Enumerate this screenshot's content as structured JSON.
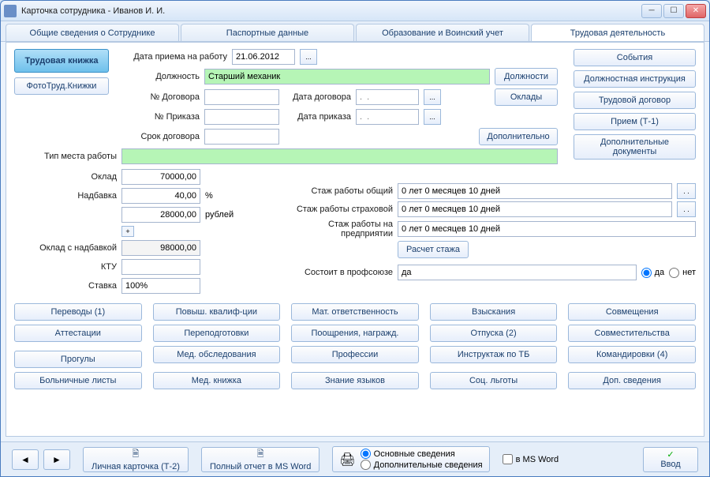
{
  "title": "Карточка сотрудника -  Иванов И. И.",
  "tabs": [
    "Общие сведения о Сотруднике",
    "Паспортные данные",
    "Образование и Воинский учет",
    "Трудовая деятельность"
  ],
  "left": {
    "workbook": "Трудовая книжка",
    "photo": "ФотоТруд.Книжки"
  },
  "right": {
    "events": "События",
    "jobdesc": "Должностная инструкция",
    "contract": "Трудовой  договор",
    "hire": "Прием (Т-1)",
    "adddocs": "Дополнительные документы"
  },
  "fields": {
    "hiredate_lbl": "Дата приема на работу",
    "hiredate": "21.06.2012",
    "position_lbl": "Должность",
    "position": "Старший механик",
    "positions_btn": "Должности",
    "contractno_lbl": "№ Договора",
    "contractdate_lbl": "Дата договора",
    "orderno_lbl": "№ Приказа",
    "orderdate_lbl": "Дата приказа",
    "dateplh": ".  .",
    "salaries_btn": "Оклады",
    "contractterm_lbl": "Срок договора",
    "additional_btn": "Дополнительно",
    "worktype_lbl": "Тип места работы",
    "salary_lbl": "Оклад",
    "salary": "70000,00",
    "bonus_lbl": "Надбавка",
    "bonus_pct": "40,00",
    "pct": "%",
    "bonus_rub": "28000,00",
    "rub": "рублей",
    "salarytotal_lbl": "Оклад с надбавкой",
    "salarytotal": "98000,00",
    "ktu_lbl": "КТУ",
    "rate_lbl": "Ставка",
    "rate": "100%",
    "stazh_total_lbl": "Стаж работы общий",
    "stazh_ins_lbl": "Стаж работы страховой",
    "stazh_ent_lbl": "Стаж работы на предприятии",
    "stazh_val": "0 лет 0 месяцев 10 дней",
    "calc_btn": "Расчет стажа",
    "union_lbl": "Состоит в профсоюзе",
    "union_val": "да",
    "yes": "да",
    "no": "нет"
  },
  "btns": [
    "Переводы (1)",
    "Повыш. квалиф-ции",
    "Мат. ответственность",
    "Взыскания",
    "Совмещения",
    "Аттестации",
    "Переподготовки",
    "Поощрения, награжд.",
    "Отпуска (2)",
    "Совместительства",
    "Прогулы",
    "Мед. обследования",
    "Профессии",
    "Инструктаж по ТБ",
    "Командировки (4)",
    "Больничные листы",
    "Мед. книжка",
    "Знание языков",
    "Соц. льготы",
    "Доп. сведения"
  ],
  "bottom": {
    "t2": "Личная карточка (Т-2)",
    "full": "Полный отчет в MS Word",
    "basic": "Основные сведения",
    "add": "Дополнительные сведения",
    "msword": "в MS Word",
    "enter": "Ввод"
  }
}
